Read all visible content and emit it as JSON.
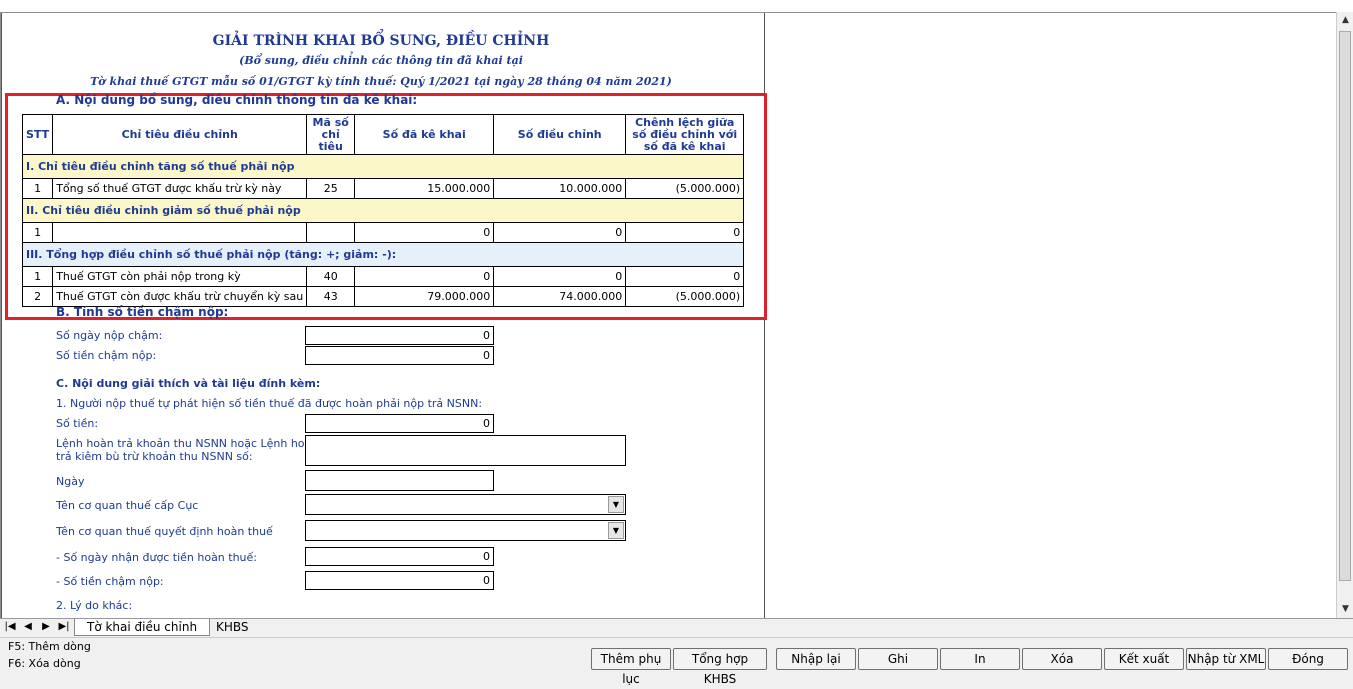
{
  "header": {
    "title": "GIẢI TRÌNH KHAI BỔ SUNG, ĐIỀU CHỈNH",
    "subtitle": "(Bổ sung, điều chỉnh các thông tin đã khai tại",
    "subtitle2": "Tờ khai thuế GTGT mẫu số 01/GTGT kỳ tính thuế: Quý 1/2021 tại ngày 28 tháng 04 năm 2021)"
  },
  "sectionA": {
    "heading": "A. Nội dung bổ sung, điều chỉnh thông tin đã kê khai:",
    "columns": [
      "STT",
      "Chỉ tiêu điều chỉnh",
      "Mã số chỉ tiêu",
      "Số đã kê khai",
      "Số điều chỉnh",
      "Chênh lệch giữa số điều chỉnh với số đã kê khai"
    ],
    "group1": "I. Chỉ tiêu điều chỉnh tăng số thuế phải nộp",
    "group1_rows": [
      {
        "stt": "1",
        "name": "Tổng số thuế GTGT được khấu trừ kỳ này",
        "code": "25",
        "declared": "15.000.000",
        "adjusted": "10.000.000",
        "diff": "(5.000.000)"
      }
    ],
    "group2": "II. Chỉ tiêu điều chỉnh giảm số thuế phải nộp",
    "group2_rows": [
      {
        "stt": "1",
        "name": "",
        "code": "",
        "declared": "0",
        "adjusted": "0",
        "diff": "0"
      }
    ],
    "group3": "III. Tổng hợp điều chỉnh số thuế phải nộp (tăng: +; giảm: -):",
    "group3_rows": [
      {
        "stt": "1",
        "name": "Thuế GTGT còn phải nộp trong kỳ",
        "code": "40",
        "declared": "0",
        "adjusted": "0",
        "diff": "0"
      },
      {
        "stt": "2",
        "name": "Thuế GTGT còn được khấu trừ chuyển kỳ sau",
        "code": "43",
        "declared": "79.000.000",
        "adjusted": "74.000.000",
        "diff": "(5.000.000)"
      }
    ]
  },
  "sectionB": {
    "heading": "B. Tính số tiền chậm nộp:",
    "late_days_label": "Số ngày nộp chậm:",
    "late_days_value": "0",
    "late_amount_label": "Số tiền chậm nộp:",
    "late_amount_value": "0"
  },
  "sectionC": {
    "heading": "C. Nội dung giải thích và tài liệu đính kèm:",
    "item1": "1. Người nộp thuế tự phát hiện số tiền thuế đã được hoàn phải nộp trả NSNN:",
    "amount_label": "Số tiền:",
    "amount_value": "0",
    "order_label_1": "Lệnh hoàn trả khoản thu NSNN hoặc Lệnh hoàn",
    "order_label_2": "trả kiêm bù trừ khoản thu NSNN số:",
    "order_value": "",
    "date_label": "Ngày",
    "date_value": "",
    "dept_label": "Tên cơ quan thuế cấp Cục",
    "dept_value": "",
    "decision_label": "Tên cơ quan thuế quyết định hoàn thuế",
    "decision_value": "",
    "refund_days_label": "- Số ngày nhận được tiền hoàn thuế:",
    "refund_days_value": "0",
    "late_amount_label": "- Số tiền chậm nộp:",
    "late_amount_value": "0",
    "item2": "2. Lý do khác:"
  },
  "tabs": {
    "tab1": "Tờ khai điều chỉnh",
    "tab2": "KHBS"
  },
  "hints": {
    "f5": "F5: Thêm dòng",
    "f6": "F6: Xóa dòng"
  },
  "buttons": {
    "add_appendix": "Thêm phụ lục",
    "summary": "Tổng hợp KHBS",
    "reenter": "Nhập lại",
    "save": "Ghi",
    "print": "In",
    "delete": "Xóa",
    "export": "Kết xuất",
    "import_xml": "Nhập từ XML",
    "close": "Đóng"
  }
}
